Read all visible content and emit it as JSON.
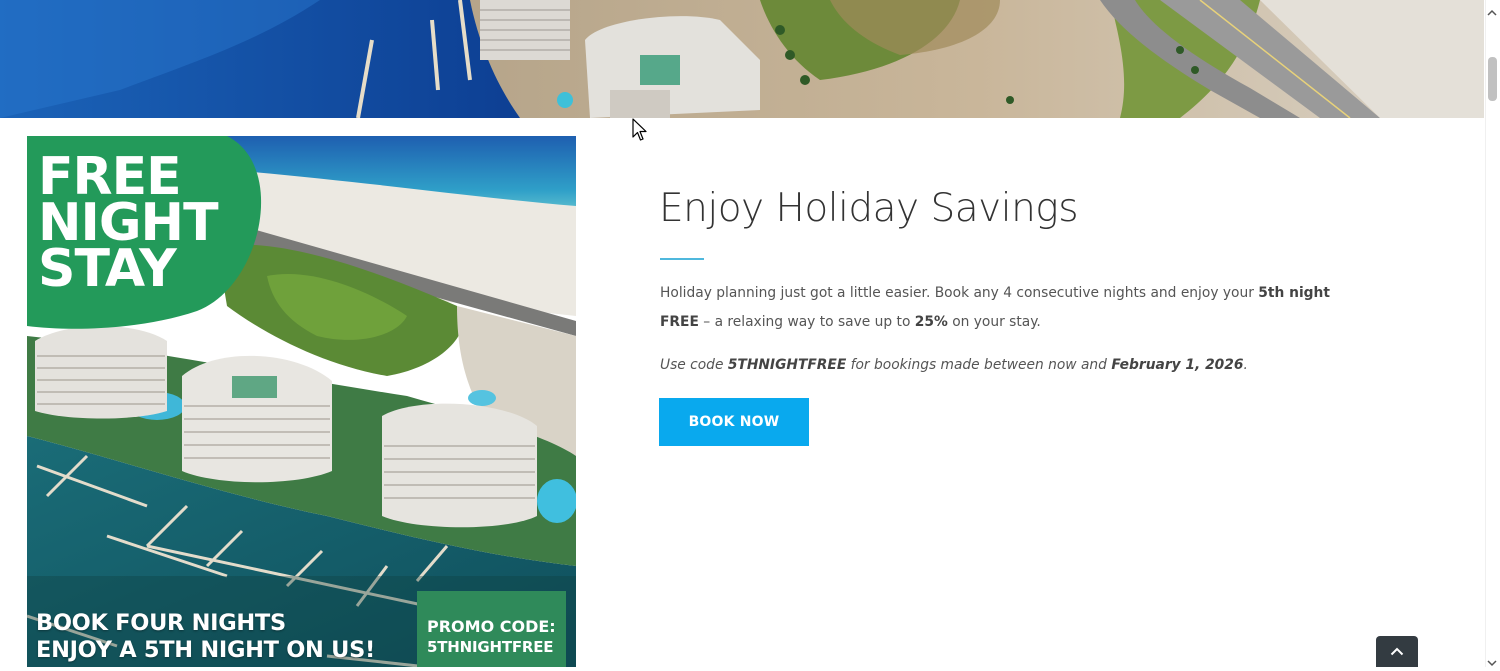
{
  "banner": {
    "alt_label": ""
  },
  "promo_image": {
    "headline_lines": [
      "FREE",
      "NIGHT",
      "STAY"
    ],
    "bottom_lines": [
      "BOOK FOUR NIGHTS",
      "ENJOY A 5TH NIGHT ON US!"
    ],
    "promo_label": "PROMO CODE:",
    "promo_code": "5THNIGHTFREE",
    "brand_green": "#239a5a"
  },
  "content": {
    "heading": "Enjoy Holiday Savings",
    "para_part1": "Holiday planning just got a little easier. Book any 4 consecutive nights and enjoy your ",
    "para_bold1": "5th night FREE",
    "para_part2": " – a relaxing way to save up to ",
    "para_bold2": "25%",
    "para_part3": " on your stay.",
    "note_part1": "Use code ",
    "note_code": "5THNIGHTFREE",
    "note_part2": " for bookings made between now and ",
    "note_date": "February 1, 2026",
    "note_part3": ".",
    "book_button": "BOOK NOW",
    "accent_color": "#09a9ee",
    "divider_color": "#4fb8dd"
  },
  "controls": {
    "back_to_top_icon": "chevron-up-icon",
    "cursor_icon": "arrow-cursor-icon"
  }
}
